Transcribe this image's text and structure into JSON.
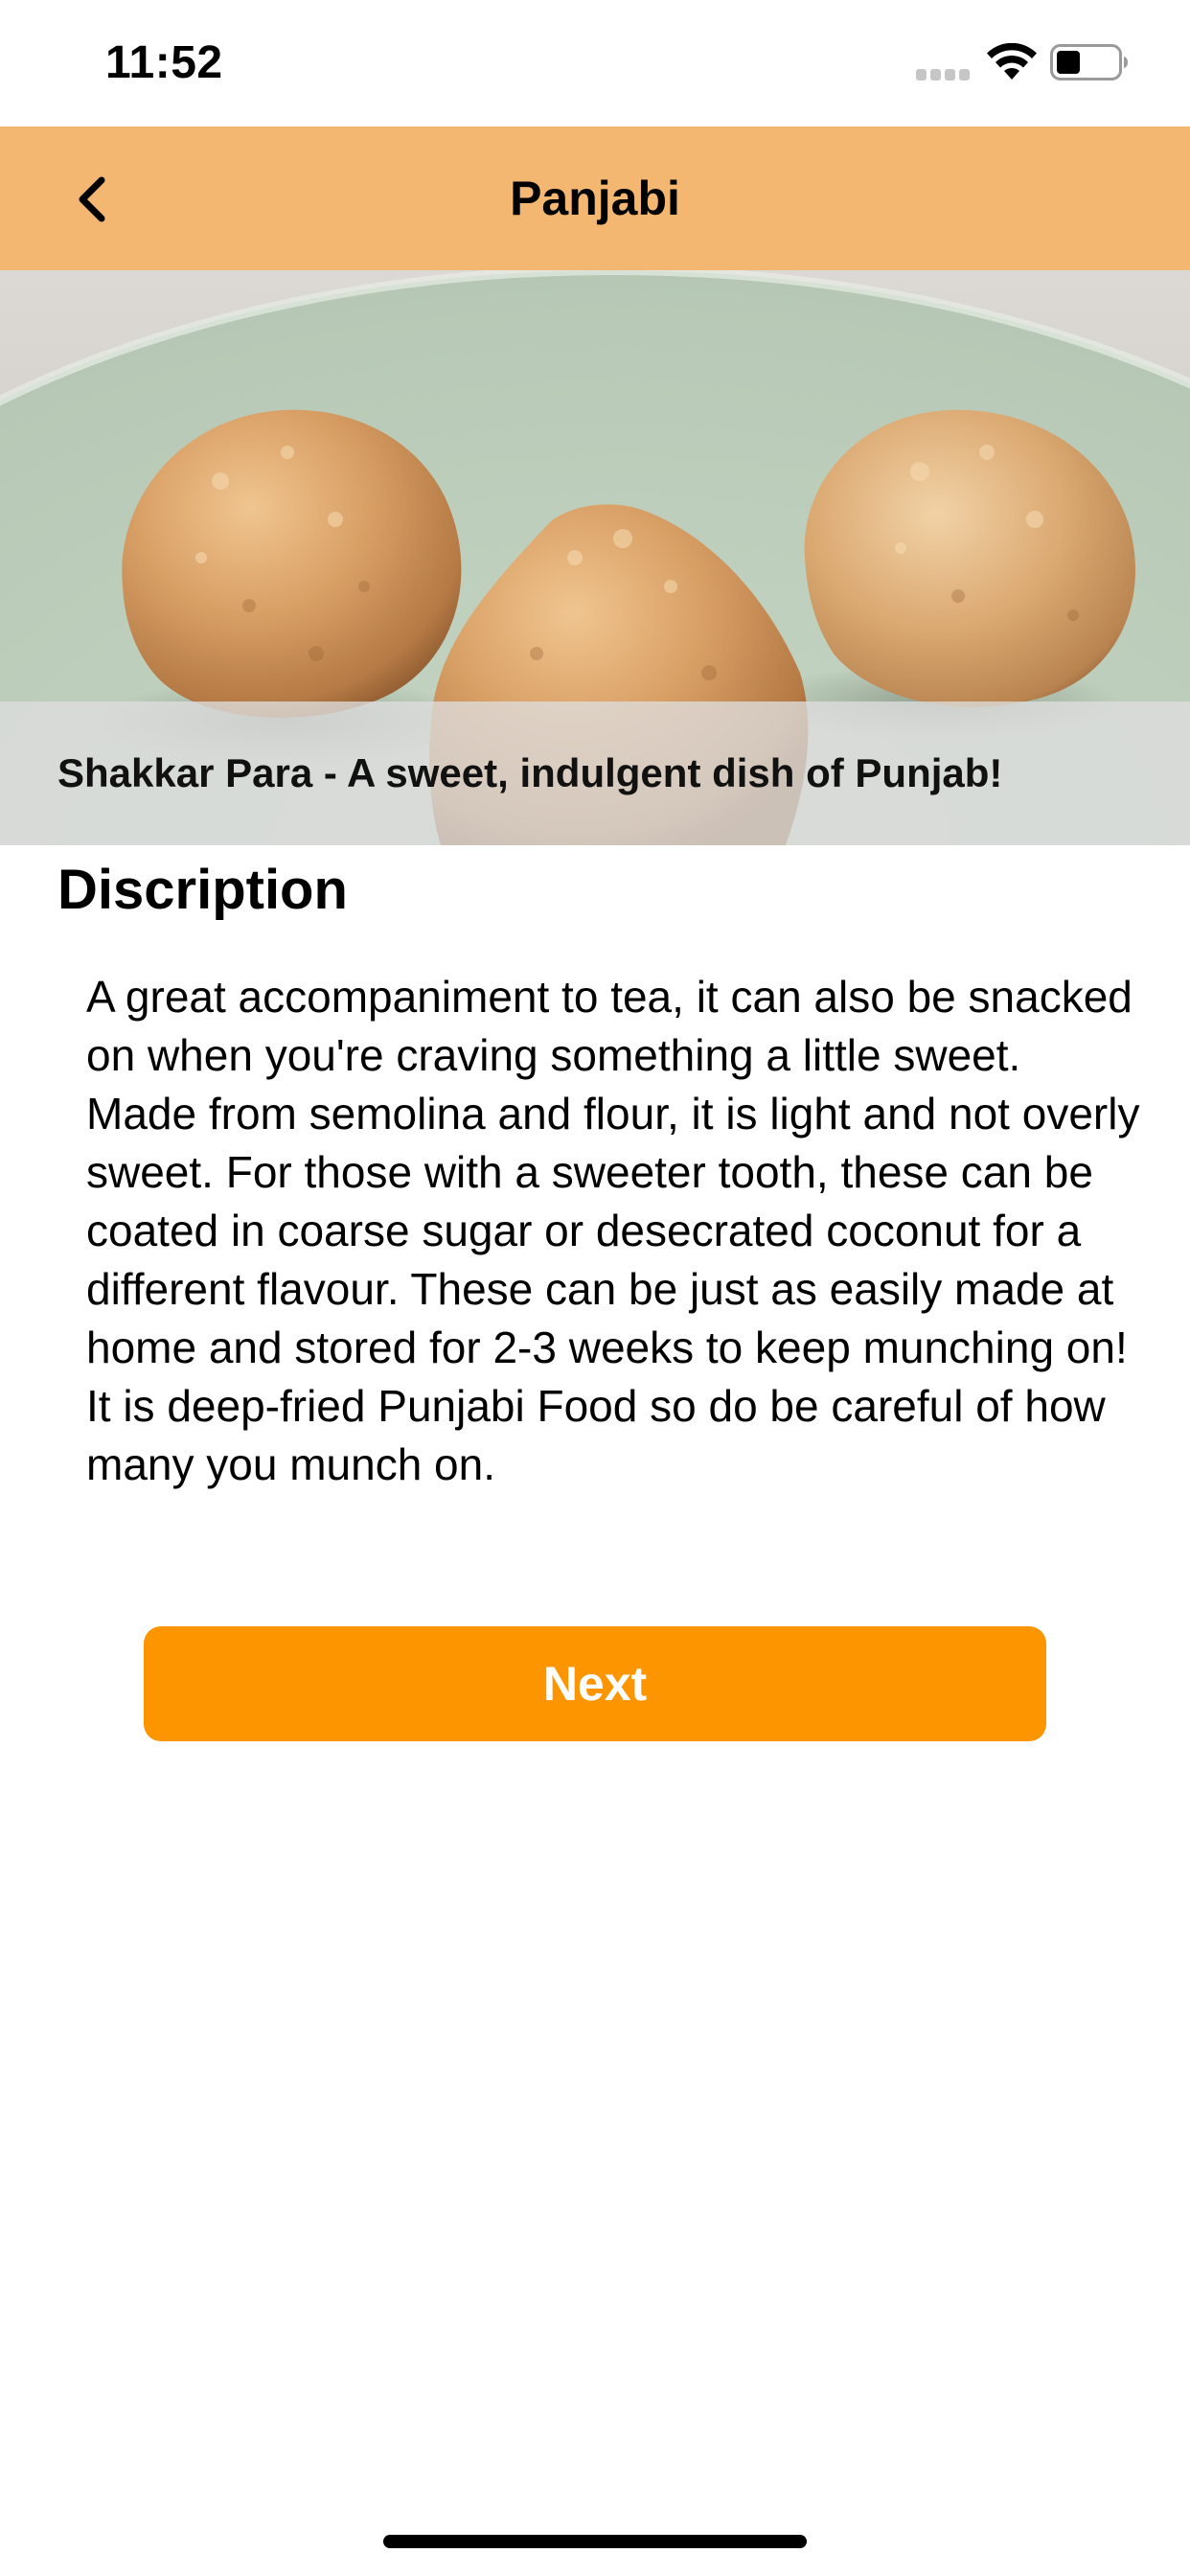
{
  "status_bar": {
    "time": "11:52",
    "icons": [
      "signal-icon",
      "wifi-icon",
      "battery-icon"
    ]
  },
  "nav_bar": {
    "title": "Panjabi",
    "back_icon": "chevron-left-icon",
    "background_color": "#f3b772"
  },
  "hero": {
    "caption": "Shakkar Para - A sweet, indulgent dish of Punjab!"
  },
  "description": {
    "heading": "Discription",
    "body": "A great accompaniment to tea, it can also be snacked on when you're craving something a little sweet. Made from semolina and flour, it is light and not overly sweet. For those with a sweeter tooth, these can be coated in coarse sugar or desecrated coconut for a different flavour. These can be just as easily made at home and stored for 2-3 weeks to keep munching on! It is deep-fried Punjabi Food so do be careful of how many you munch on."
  },
  "actions": {
    "next_label": "Next",
    "next_color": "#fd9500"
  }
}
